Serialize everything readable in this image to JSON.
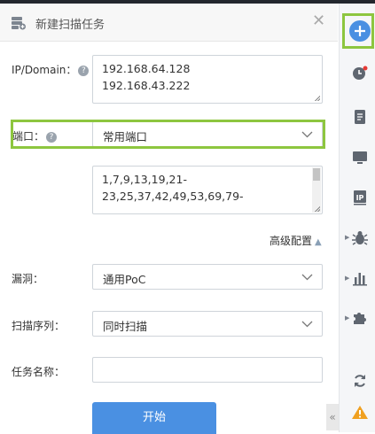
{
  "dialog": {
    "title": "新建扫描任务",
    "close_symbol": "✕"
  },
  "form": {
    "ip_label": "IP/Domain：",
    "ip_values": [
      "192.168.64.128",
      "192.168.43.222"
    ],
    "port_label": "端口：",
    "port_select_value": "常用端口",
    "port_list": [
      "1,7,9,13,19,21-",
      "23,25,37,42,49,53,69,79-"
    ],
    "advanced_label": "高级配置",
    "vuln_label": "漏洞：",
    "vuln_select_value": "通用PoC",
    "order_label": "扫描序列：",
    "order_select_value": "同时扫描",
    "taskname_label": "任务名称：",
    "taskname_value": "",
    "start_button": "开始"
  },
  "sidebar": {
    "icons": [
      "add-icon",
      "history-clock-icon",
      "document-icon",
      "monitor-icon",
      "ip-icon",
      "bug-icon",
      "bar-chart-icon",
      "puzzle-plugin-icon",
      "refresh-icon",
      "warning-icon"
    ],
    "ip_text": "IP"
  },
  "colors": {
    "accent": "#4a90e2",
    "highlight": "#8dc63f",
    "icon": "#5f6670",
    "warning": "#f0a020",
    "badge": "#e53935"
  }
}
